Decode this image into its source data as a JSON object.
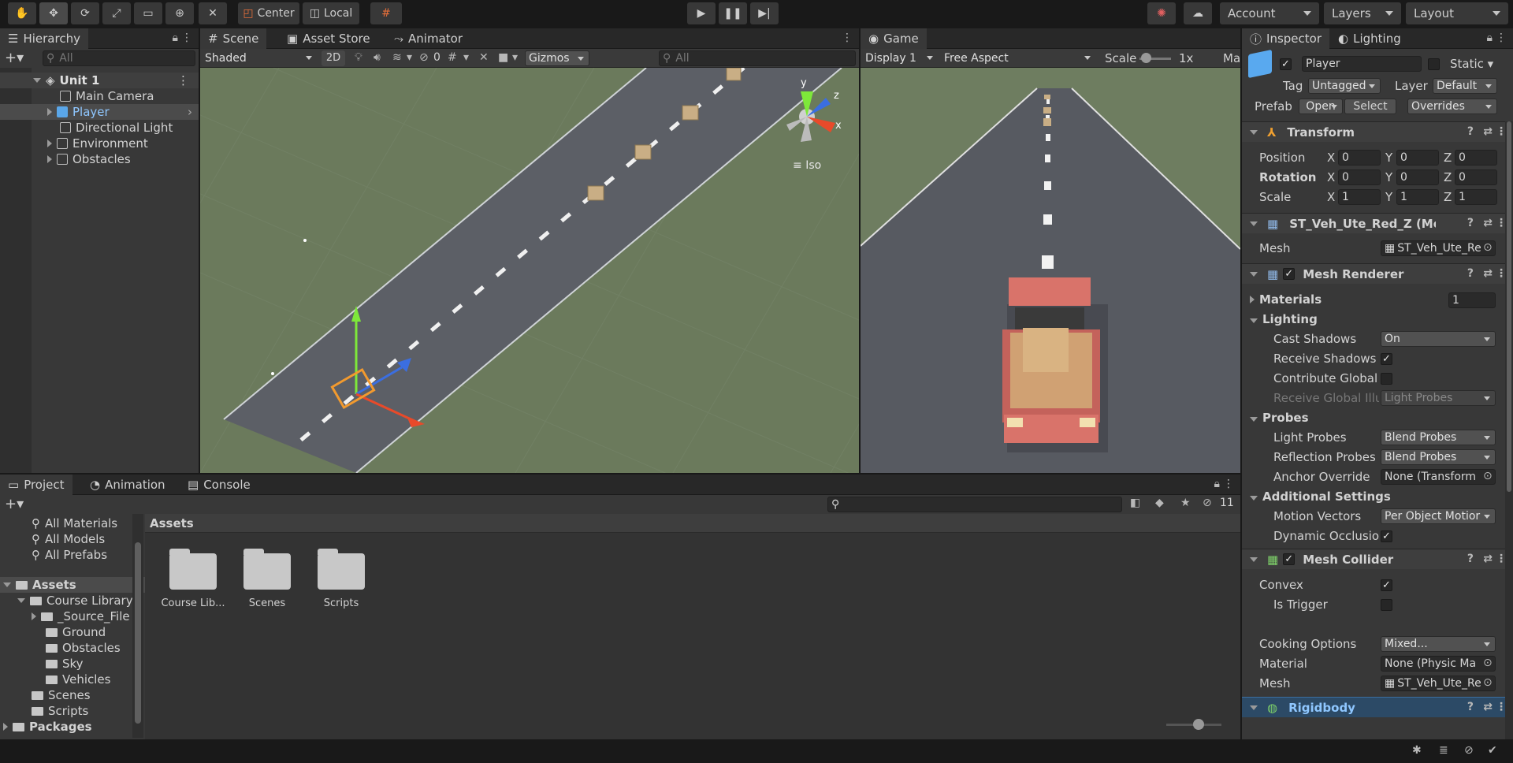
{
  "toolbar": {
    "center": "Center",
    "local": "Local",
    "account": "Account",
    "layers": "Layers",
    "layout": "Layout"
  },
  "hierarchy": {
    "tab": "Hierarchy",
    "search_placeholder": "All",
    "scene": "Unit 1",
    "items": [
      {
        "label": "Main Camera"
      },
      {
        "label": "Player"
      },
      {
        "label": "Directional Light"
      },
      {
        "label": "Environment"
      },
      {
        "label": "Obstacles"
      }
    ]
  },
  "scene_view": {
    "tabs": [
      "Scene",
      "Asset Store",
      "Animator"
    ],
    "shading": "Shaded",
    "mode_2d": "2D",
    "hidden_count": "0",
    "gizmos": "Gizmos",
    "search_placeholder": "All",
    "projection": "Iso",
    "axis_x": "x",
    "axis_y": "y",
    "axis_z": "z"
  },
  "game_view": {
    "tab": "Game",
    "display": "Display 1",
    "aspect": "Free Aspect",
    "scale_label": "Scale",
    "scale_value": "1x",
    "cut": "Ma"
  },
  "project": {
    "tabs": [
      "Project",
      "Animation",
      "Console"
    ],
    "hidden_count": "11",
    "favorites": [
      "All Materials",
      "All Models",
      "All Prefabs"
    ],
    "tree": {
      "assets": "Assets",
      "course_library": "Course Library",
      "children": [
        "_Source_File",
        "Ground",
        "Obstacles",
        "Sky",
        "Vehicles"
      ],
      "scenes": "Scenes",
      "scripts": "Scripts",
      "packages": "Packages"
    },
    "breadcrumb": "Assets",
    "grid": [
      "Course Lib...",
      "Scenes",
      "Scripts"
    ]
  },
  "inspector": {
    "tabs": [
      "Inspector",
      "Lighting"
    ],
    "object_name": "Player",
    "static": "Static",
    "tag_label": "Tag",
    "tag_value": "Untagged",
    "layer_label": "Layer",
    "layer_value": "Default",
    "prefab_label": "Prefab",
    "open": "Open",
    "select": "Select",
    "overrides": "Overrides",
    "transform": {
      "title": "Transform",
      "position": "Position",
      "rotation": "Rotation",
      "scale": "Scale",
      "x": "X",
      "y": "Y",
      "z": "Z",
      "pos": [
        "0",
        "0",
        "0"
      ],
      "rot": [
        "0",
        "0",
        "0"
      ],
      "scl": [
        "1",
        "1",
        "1"
      ]
    },
    "mesh_filter": {
      "title": "ST_Veh_Ute_Red_Z (Mé",
      "mesh_label": "Mesh",
      "mesh_value": "ST_Veh_Ute_Re"
    },
    "mesh_renderer": {
      "title": "Mesh Renderer",
      "materials": "Materials",
      "materials_count": "1",
      "lighting": "Lighting",
      "cast_shadows": "Cast Shadows",
      "cast_shadows_value": "On",
      "receive_shadows": "Receive Shadows",
      "contribute_global": "Contribute Global",
      "receive_global": "Receive Global Illu",
      "receive_global_value": "Light Probes",
      "probes": "Probes",
      "light_probes": "Light Probes",
      "light_probes_value": "Blend Probes",
      "reflection_probes": "Reflection Probes",
      "reflection_probes_value": "Blend Probes",
      "anchor_override": "Anchor Override",
      "anchor_override_value": "None (Transform",
      "additional": "Additional Settings",
      "motion_vectors": "Motion Vectors",
      "motion_vectors_value": "Per Object Motior",
      "dynamic_occlusion": "Dynamic Occlusio"
    },
    "mesh_collider": {
      "title": "Mesh Collider",
      "convex": "Convex",
      "is_trigger": "Is Trigger",
      "cooking": "Cooking Options",
      "cooking_value": "Mixed...",
      "material": "Material",
      "material_value": "None (Physic Ma",
      "mesh": "Mesh",
      "mesh_value": "ST_Veh_Ute_Re"
    },
    "rigidbody": {
      "title": "Rigidbody"
    }
  },
  "colors": {
    "accent_blue": "#2c5d87",
    "selected_row": "#4b4b4b",
    "ground": "#6b7a5c",
    "road": "#5c5f66",
    "truck": "#d9736a"
  }
}
